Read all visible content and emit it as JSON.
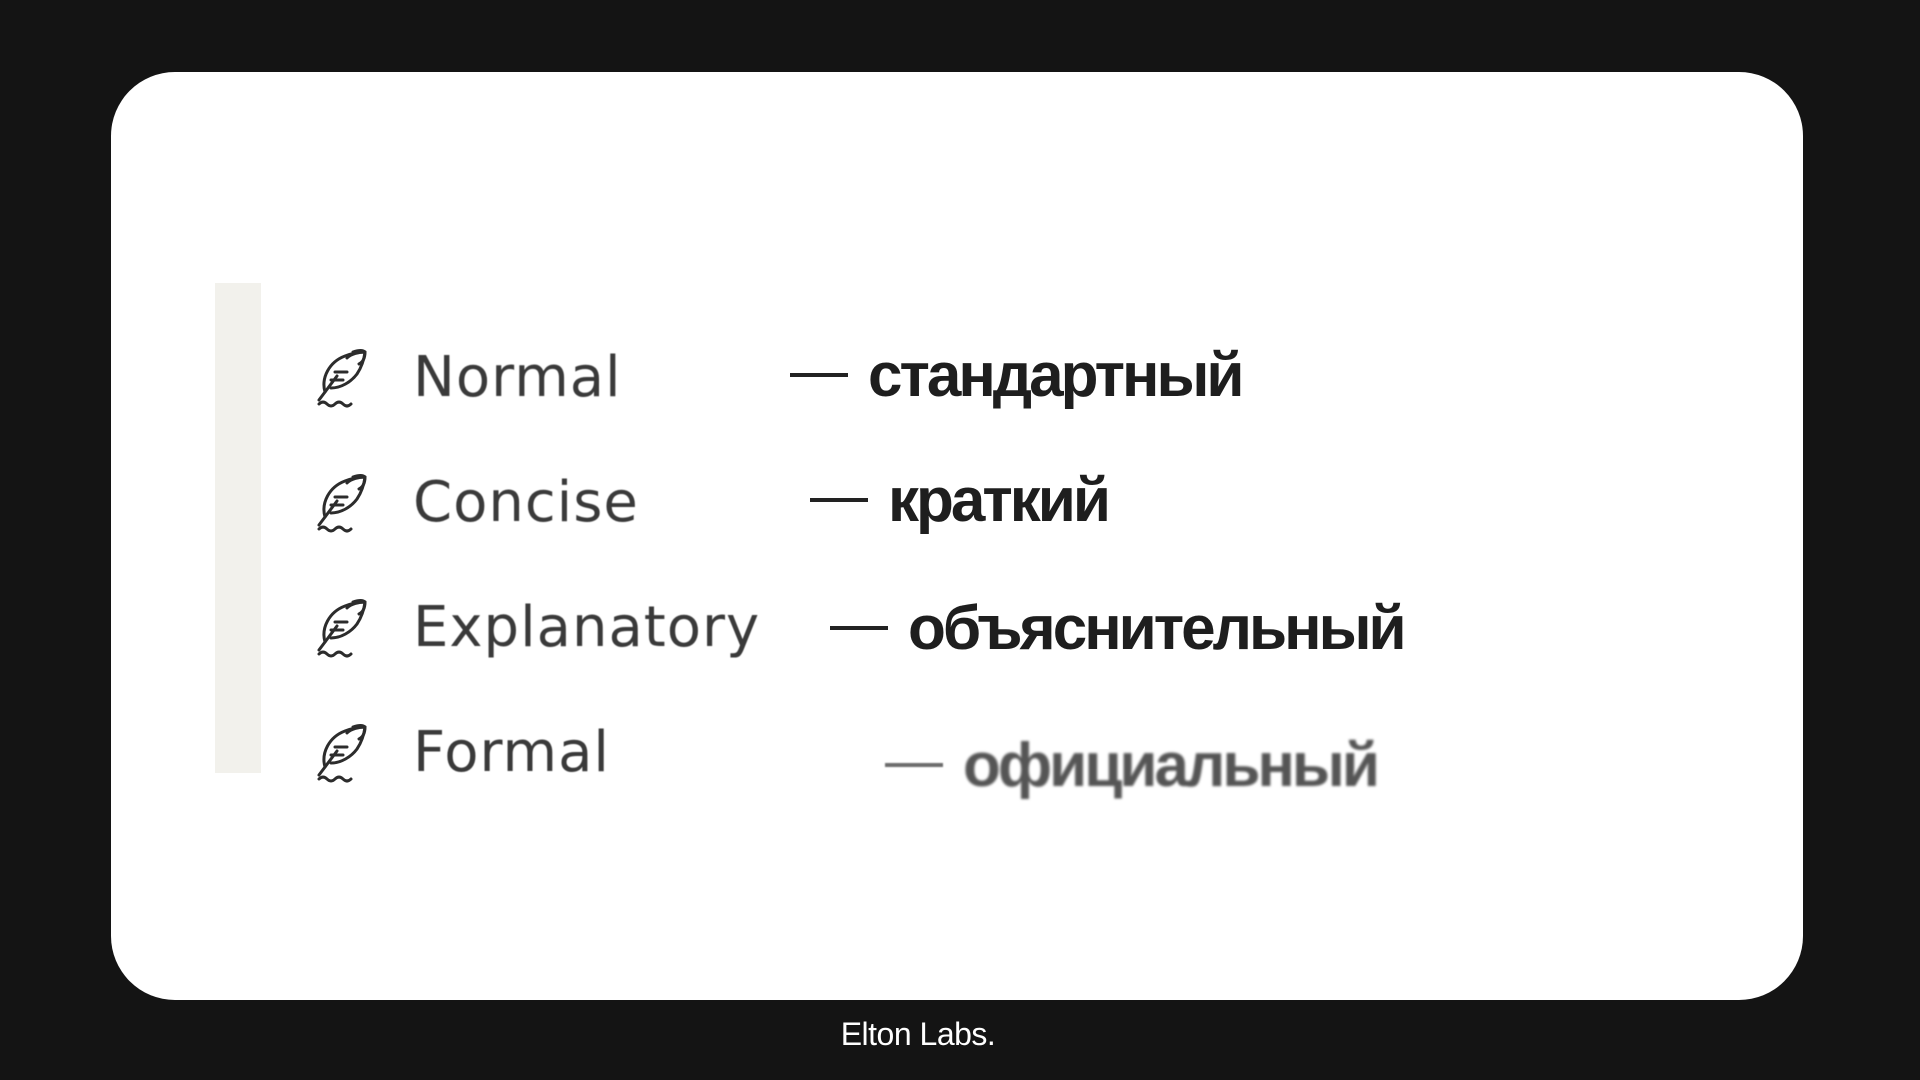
{
  "menu": {
    "items": [
      {
        "label": "Normal",
        "icon": "quill-icon",
        "translation": "стандартный"
      },
      {
        "label": "Concise",
        "icon": "quill-icon",
        "translation": "краткий"
      },
      {
        "label": "Explanatory",
        "icon": "quill-icon",
        "translation": "объяснительный"
      },
      {
        "label": "Formal",
        "icon": "quill-icon",
        "translation": "официальный"
      }
    ]
  },
  "dash": "—",
  "footer": {
    "brand": "Elton Labs."
  },
  "colors": {
    "background": "#141414",
    "card": "#ffffff",
    "menu_bar": "#f2f1ec",
    "label_text": "#3a3a3a",
    "translation_text": "#1e1e1e"
  }
}
